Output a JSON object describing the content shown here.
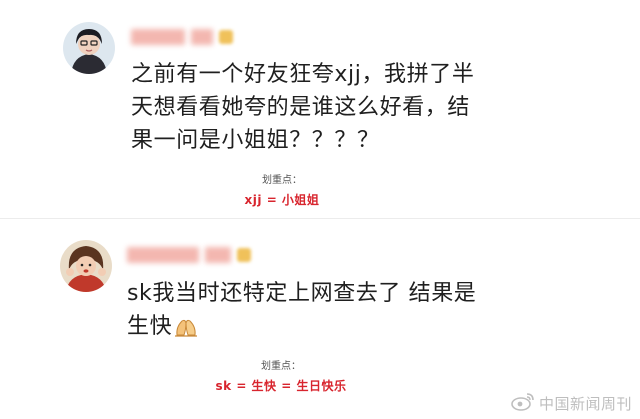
{
  "comments": [
    {
      "username": "",
      "text_lines": [
        "之前有一个好友狂夸xjj，我拼了半",
        "天想看看她夸的是谁这么好看，结",
        "果一问是小姐姐？？？？"
      ],
      "highlight": {
        "label": "划重点：",
        "value": "xjj = 小姐姐"
      }
    },
    {
      "username": "",
      "text_lines": [
        "sk我当时还特定上网查去了 结果是",
        "生快"
      ],
      "highlight": {
        "label": "划重点：",
        "value": "sk = 生快 = 生日快乐"
      }
    }
  ],
  "colors": {
    "highlight": "#d8252e",
    "name_blur": "#f2b0a8"
  },
  "icons": {
    "comment2_emoji": "praying-hands-emoji",
    "watermark_logo": "weibo-logo-icon"
  },
  "watermark": {
    "text": "中国新闻周刊"
  }
}
